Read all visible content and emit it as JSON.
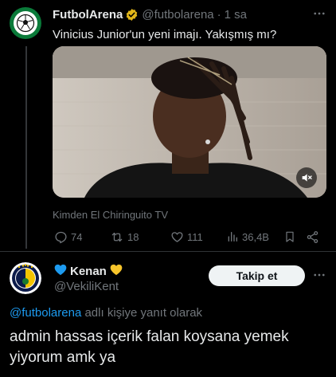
{
  "parent_tweet": {
    "name": "FutbolArena",
    "handle": "@futbolarena",
    "separator": "·",
    "time": "1 sa",
    "text": "Vinicius Junior'un yeni imajı. Yakışmış mı?",
    "source": "Kimden El Chiringuito TV",
    "actions": {
      "replies": "74",
      "retweets": "18",
      "likes": "111",
      "views": "36,4B"
    }
  },
  "reply_tweet": {
    "name": "Kenan",
    "handle": "@VekiliKent",
    "follow_label": "Takip et",
    "reply_to_prefix": "@futbolarena",
    "reply_to_suffix": " adlı kişiye yanıt olarak",
    "text": "admin hassas içerik falan koysana yemek yiyorum amk ya"
  },
  "colors": {
    "background": "#000000",
    "text": "#e7e9ea",
    "muted": "#71767b",
    "accent": "#1d9bf0",
    "verified_gold": "#e2b719"
  }
}
